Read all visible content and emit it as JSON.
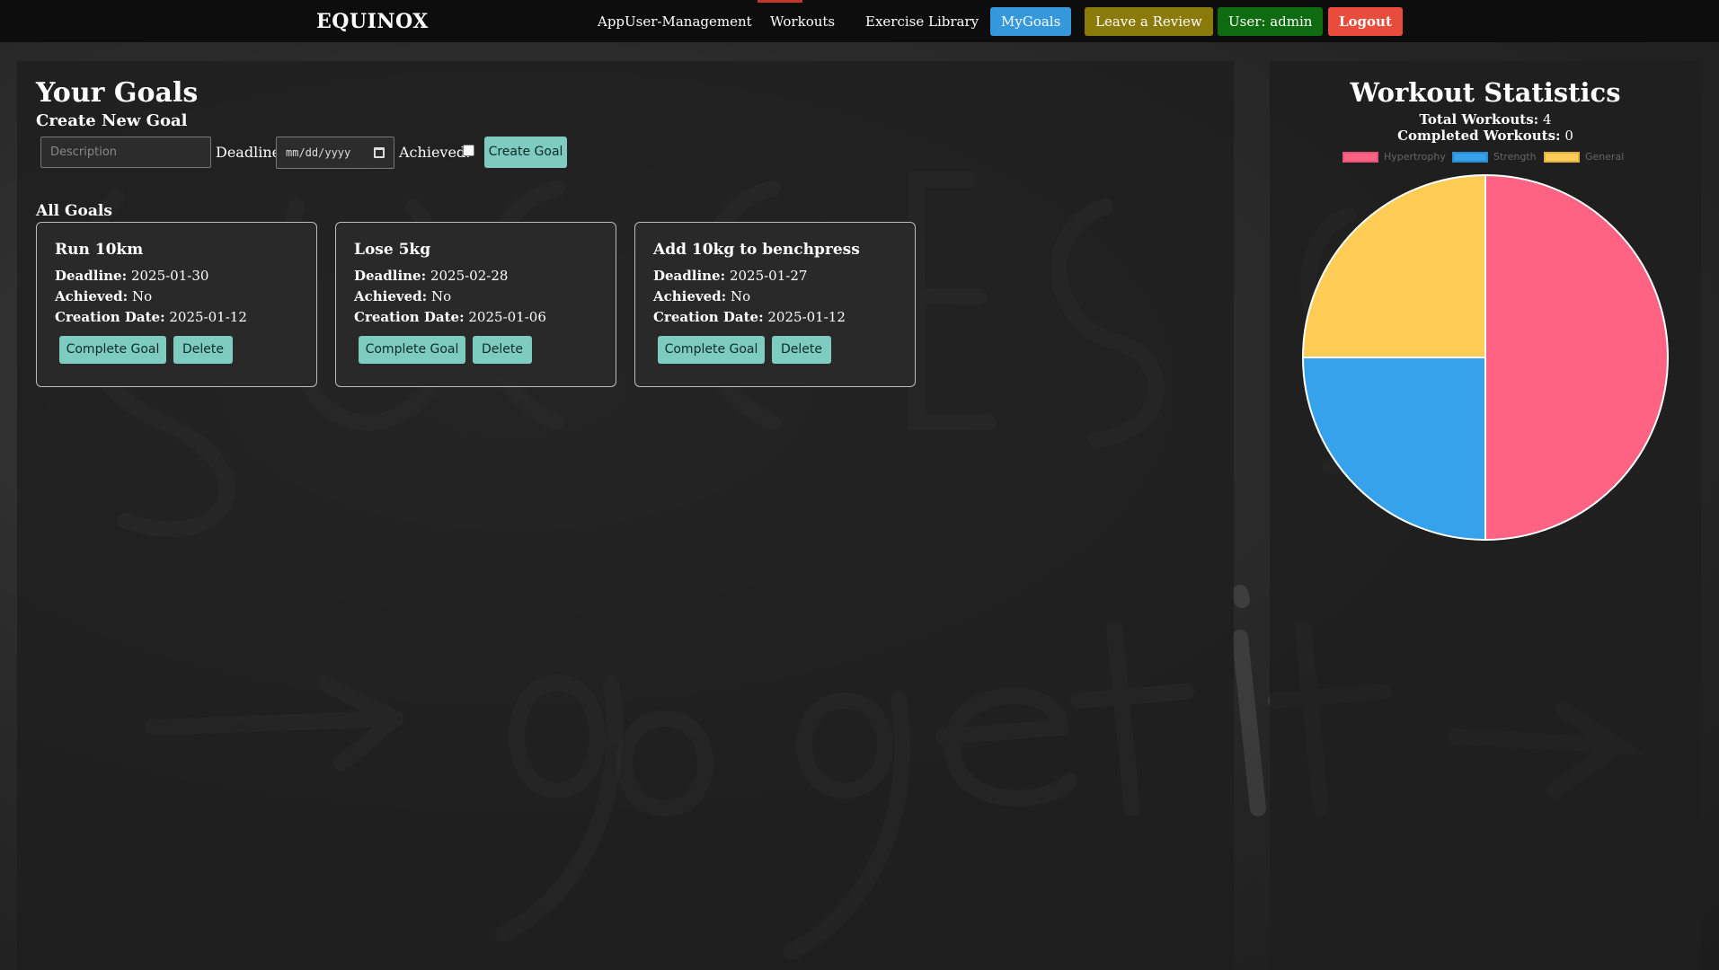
{
  "navbar": {
    "brand": "EQUINOX",
    "links": [
      "AppUser-Management",
      "Workouts",
      "Exercise Library"
    ],
    "buttons": {
      "mygoals": "MyGoals",
      "review": "Leave a Review",
      "user": "User: admin",
      "logout": "Logout"
    }
  },
  "goals": {
    "title": "Your Goals",
    "create_title": "Create New Goal",
    "form": {
      "description_placeholder": "Description",
      "deadline_label": "Deadline:",
      "deadline_placeholder": "mm/dd/yyyy",
      "achieved_label": "Achieved:",
      "create_button": "Create Goal"
    },
    "all_goals_title": "All Goals",
    "field_labels": {
      "deadline": "Deadline:",
      "achieved": "Achieved:",
      "creation_date": "Creation Date:"
    },
    "items": [
      {
        "name": "Run 10km",
        "deadline": "2025-01-30",
        "achieved": "No",
        "creation_date": "2025-01-12",
        "complete_label": "Complete Goal",
        "delete_label": "Delete"
      },
      {
        "name": "Lose 5kg",
        "deadline": "2025-02-28",
        "achieved": "No",
        "creation_date": "2025-01-06",
        "complete_label": "Complete Goal",
        "delete_label": "Delete"
      },
      {
        "name": "Add 10kg to benchpress",
        "deadline": "2025-01-27",
        "achieved": "No",
        "creation_date": "2025-01-12",
        "complete_label": "Complete Goal",
        "delete_label": "Delete"
      }
    ]
  },
  "stats": {
    "title": "Workout Statistics",
    "total_label": "Total Workouts:",
    "total_value": "4",
    "completed_label": "Completed Workouts:",
    "completed_value": "0"
  },
  "colors": {
    "mygoals_btn": "#3498db",
    "review_btn": "#8a7a0a",
    "user_btn": "#0f6b0f",
    "logout_btn": "#e74c3c",
    "teal_btn": "#7ecbc0"
  },
  "chart_data": {
    "type": "pie",
    "categories": [
      "Hypertrophy",
      "Strength",
      "General"
    ],
    "values": [
      2,
      1,
      1
    ],
    "colors": [
      "#ff6384",
      "#36a2eb",
      "#ffcd56"
    ],
    "legend": "top"
  }
}
